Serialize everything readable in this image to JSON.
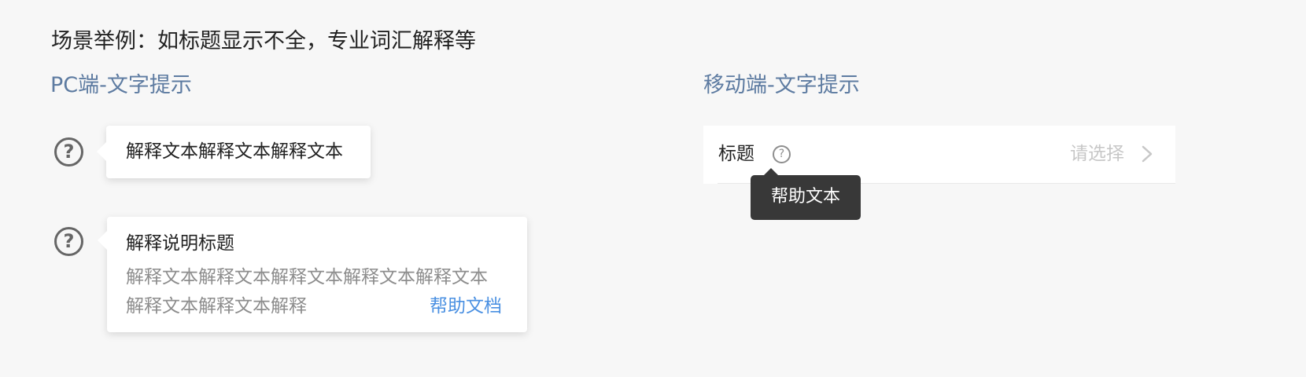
{
  "scene_title": "场景举例：如标题显示不全，专业词汇解释等",
  "pc": {
    "section_title": "PC端-文字提示",
    "help_icon_glyph": "?",
    "simple_tooltip": {
      "text": "解释文本解释文本解释文本"
    },
    "rich_tooltip": {
      "title": "解释说明标题",
      "body_line1": "解释文本解释文本解释文本解释文本解释文本",
      "body_line2": "解释文本解释文本解释",
      "link": "帮助文档"
    }
  },
  "mobile": {
    "section_title": "移动端-文字提示",
    "row": {
      "label": "标题",
      "help_icon_glyph": "?",
      "value_placeholder": "请选择",
      "chevron_icon": "chevron-right-icon"
    },
    "tooltip": {
      "text": "帮助文本"
    }
  },
  "colors": {
    "background": "#f7f7f7",
    "section_title": "#5d7ba1",
    "link": "#4a90e2",
    "secondary_text": "#8d8d8d",
    "placeholder": "#c7c7c7",
    "dark_tooltip": "#383838"
  }
}
